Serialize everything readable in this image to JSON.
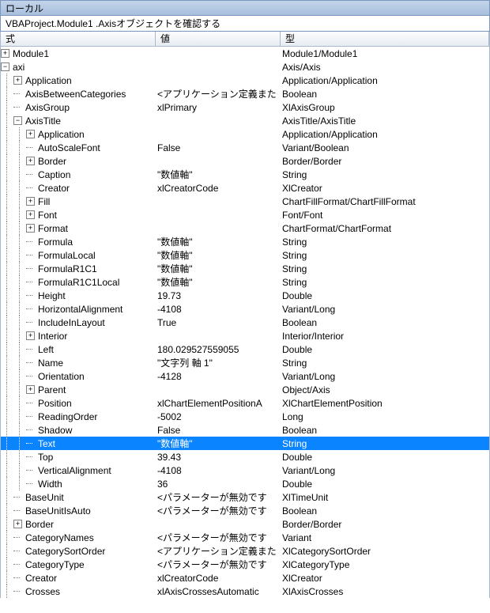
{
  "title": "ローカル",
  "path": "VBAProject.Module1 .Axisオブジェクトを確認する",
  "columns": {
    "expr": "式",
    "value": "値",
    "type": "型"
  },
  "rows": [
    {
      "indent": 0,
      "icon": "plus",
      "name": "Module1",
      "value": "",
      "type": "Module1/Module1"
    },
    {
      "indent": 0,
      "icon": "minus",
      "name": "axi",
      "value": "",
      "type": "Axis/Axis"
    },
    {
      "indent": 1,
      "icon": "plus",
      "name": "Application",
      "value": "",
      "type": "Application/Application"
    },
    {
      "indent": 1,
      "icon": "leaf",
      "name": "AxisBetweenCategories",
      "value": "<アプリケーション定義また",
      "type": "Boolean"
    },
    {
      "indent": 1,
      "icon": "leaf",
      "name": "AxisGroup",
      "value": "xlPrimary",
      "type": "XlAxisGroup"
    },
    {
      "indent": 1,
      "icon": "minus",
      "name": "AxisTitle",
      "value": "",
      "type": "AxisTitle/AxisTitle"
    },
    {
      "indent": 2,
      "icon": "plus",
      "name": "Application",
      "value": "",
      "type": "Application/Application"
    },
    {
      "indent": 2,
      "icon": "leaf",
      "name": "AutoScaleFont",
      "value": "False",
      "type": "Variant/Boolean"
    },
    {
      "indent": 2,
      "icon": "plus",
      "name": "Border",
      "value": "",
      "type": "Border/Border"
    },
    {
      "indent": 2,
      "icon": "leaf",
      "name": "Caption",
      "value": "\"数値軸\"",
      "type": "String"
    },
    {
      "indent": 2,
      "icon": "leaf",
      "name": "Creator",
      "value": "xlCreatorCode",
      "type": "XlCreator"
    },
    {
      "indent": 2,
      "icon": "plus",
      "name": "Fill",
      "value": "",
      "type": "ChartFillFormat/ChartFillFormat"
    },
    {
      "indent": 2,
      "icon": "plus",
      "name": "Font",
      "value": "",
      "type": "Font/Font"
    },
    {
      "indent": 2,
      "icon": "plus",
      "name": "Format",
      "value": "",
      "type": "ChartFormat/ChartFormat"
    },
    {
      "indent": 2,
      "icon": "leaf",
      "name": "Formula",
      "value": "\"数値軸\"",
      "type": "String"
    },
    {
      "indent": 2,
      "icon": "leaf",
      "name": "FormulaLocal",
      "value": "\"数値軸\"",
      "type": "String"
    },
    {
      "indent": 2,
      "icon": "leaf",
      "name": "FormulaR1C1",
      "value": "\"数値軸\"",
      "type": "String"
    },
    {
      "indent": 2,
      "icon": "leaf",
      "name": "FormulaR1C1Local",
      "value": "\"数値軸\"",
      "type": "String"
    },
    {
      "indent": 2,
      "icon": "leaf",
      "name": "Height",
      "value": "19.73",
      "type": "Double"
    },
    {
      "indent": 2,
      "icon": "leaf",
      "name": "HorizontalAlignment",
      "value": "-4108",
      "type": "Variant/Long"
    },
    {
      "indent": 2,
      "icon": "leaf",
      "name": "IncludeInLayout",
      "value": "True",
      "type": "Boolean"
    },
    {
      "indent": 2,
      "icon": "plus",
      "name": "Interior",
      "value": "",
      "type": "Interior/Interior"
    },
    {
      "indent": 2,
      "icon": "leaf",
      "name": "Left",
      "value": "180.029527559055",
      "type": "Double"
    },
    {
      "indent": 2,
      "icon": "leaf",
      "name": "Name",
      "value": "\"文字列 軸 1\"",
      "type": "String"
    },
    {
      "indent": 2,
      "icon": "leaf",
      "name": "Orientation",
      "value": "-4128",
      "type": "Variant/Long"
    },
    {
      "indent": 2,
      "icon": "plus",
      "name": "Parent",
      "value": "",
      "type": "Object/Axis"
    },
    {
      "indent": 2,
      "icon": "leaf",
      "name": "Position",
      "value": "xlChartElementPositionA",
      "type": "XlChartElementPosition"
    },
    {
      "indent": 2,
      "icon": "leaf",
      "name": "ReadingOrder",
      "value": "-5002",
      "type": "Long"
    },
    {
      "indent": 2,
      "icon": "leaf",
      "name": "Shadow",
      "value": "False",
      "type": "Boolean"
    },
    {
      "indent": 2,
      "icon": "leaf",
      "name": "Text",
      "value": "\"数値軸\"",
      "type": "String",
      "selected": true
    },
    {
      "indent": 2,
      "icon": "leaf",
      "name": "Top",
      "value": "39.43",
      "type": "Double"
    },
    {
      "indent": 2,
      "icon": "leaf",
      "name": "VerticalAlignment",
      "value": "-4108",
      "type": "Variant/Long"
    },
    {
      "indent": 2,
      "icon": "leaf",
      "name": "Width",
      "value": "36",
      "type": "Double"
    },
    {
      "indent": 1,
      "icon": "leaf",
      "name": "BaseUnit",
      "value": "<パラメーターが無効です",
      "type": "XlTimeUnit"
    },
    {
      "indent": 1,
      "icon": "leaf",
      "name": "BaseUnitIsAuto",
      "value": "<パラメーターが無効です",
      "type": "Boolean"
    },
    {
      "indent": 1,
      "icon": "plus",
      "name": "Border",
      "value": "",
      "type": "Border/Border"
    },
    {
      "indent": 1,
      "icon": "leaf",
      "name": "CategoryNames",
      "value": "<パラメーターが無効です",
      "type": "Variant"
    },
    {
      "indent": 1,
      "icon": "leaf",
      "name": "CategorySortOrder",
      "value": "<アプリケーション定義また",
      "type": "XlCategorySortOrder"
    },
    {
      "indent": 1,
      "icon": "leaf",
      "name": "CategoryType",
      "value": "<パラメーターが無効です",
      "type": "XlCategoryType"
    },
    {
      "indent": 1,
      "icon": "leaf",
      "name": "Creator",
      "value": "xlCreatorCode",
      "type": "XlCreator"
    },
    {
      "indent": 1,
      "icon": "leaf",
      "name": "Crosses",
      "value": "xlAxisCrossesAutomatic",
      "type": "XlAxisCrosses"
    }
  ]
}
